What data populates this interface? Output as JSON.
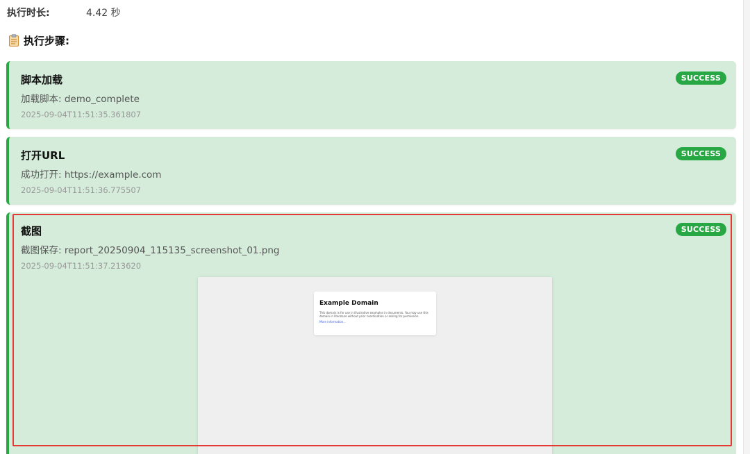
{
  "summary": {
    "duration_label": "执行时长:",
    "duration_value": "4.42 秒"
  },
  "steps_section": {
    "icon": "clipboard-icon",
    "title": "执行步骤:"
  },
  "colors": {
    "success": "#28a745",
    "card_bg": "#d4ecd9",
    "highlight": "#e53935"
  },
  "steps": [
    {
      "name": "脚本加载",
      "message": "加载脚本: demo_complete",
      "timestamp": "2025-09-04T11:51:35.361807",
      "status": "SUCCESS"
    },
    {
      "name": "打开URL",
      "message": "成功打开: https://example.com",
      "timestamp": "2025-09-04T11:51:36.775507",
      "status": "SUCCESS"
    },
    {
      "name": "截图",
      "message": "截图保存: report_20250904_115135_screenshot_01.png",
      "timestamp": "2025-09-04T11:51:37.213620",
      "status": "SUCCESS",
      "preview": {
        "title": "Example Domain",
        "text": "This domain is for use in illustrative examples in documents. You may use this domain in literature without prior coordination or asking for permission.",
        "link": "More information..."
      }
    }
  ]
}
